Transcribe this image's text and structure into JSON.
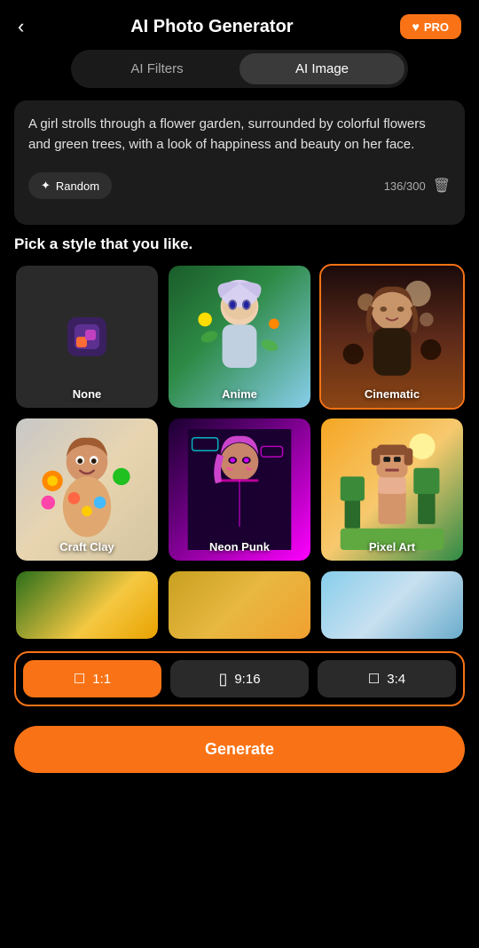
{
  "header": {
    "title": "AI Photo Generator",
    "back_label": "‹",
    "pro_label": "PRO"
  },
  "tabs": [
    {
      "id": "ai-filters",
      "label": "AI Filters",
      "active": false
    },
    {
      "id": "ai-image",
      "label": "AI Image",
      "active": true
    }
  ],
  "prompt": {
    "text": "A girl strolls through a flower garden, surrounded by colorful flowers and green trees, with a look of happiness and beauty on her face.",
    "char_count": "136/300",
    "random_label": "Random",
    "delete_icon": "🗑"
  },
  "style_section": {
    "title": "Pick a style that you like.",
    "styles": [
      {
        "id": "none",
        "label": "None",
        "selected": false
      },
      {
        "id": "anime",
        "label": "Anime",
        "selected": false
      },
      {
        "id": "cinematic",
        "label": "Cinematic",
        "selected": true
      },
      {
        "id": "craft-clay",
        "label": "Craft Clay",
        "selected": false
      },
      {
        "id": "neon-punk",
        "label": "Neon Punk",
        "selected": false
      },
      {
        "id": "pixel-art",
        "label": "Pixel Art",
        "selected": false
      },
      {
        "id": "row3-1",
        "label": "",
        "selected": false
      },
      {
        "id": "row3-2",
        "label": "",
        "selected": false
      },
      {
        "id": "row3-3",
        "label": "",
        "selected": false
      }
    ]
  },
  "aspect_ratios": [
    {
      "id": "1-1",
      "label": "1:1",
      "active": true
    },
    {
      "id": "9-16",
      "label": "9:16",
      "active": false
    },
    {
      "id": "3-4",
      "label": "3:4",
      "active": false
    }
  ],
  "generate_btn": {
    "label": "Generate"
  }
}
